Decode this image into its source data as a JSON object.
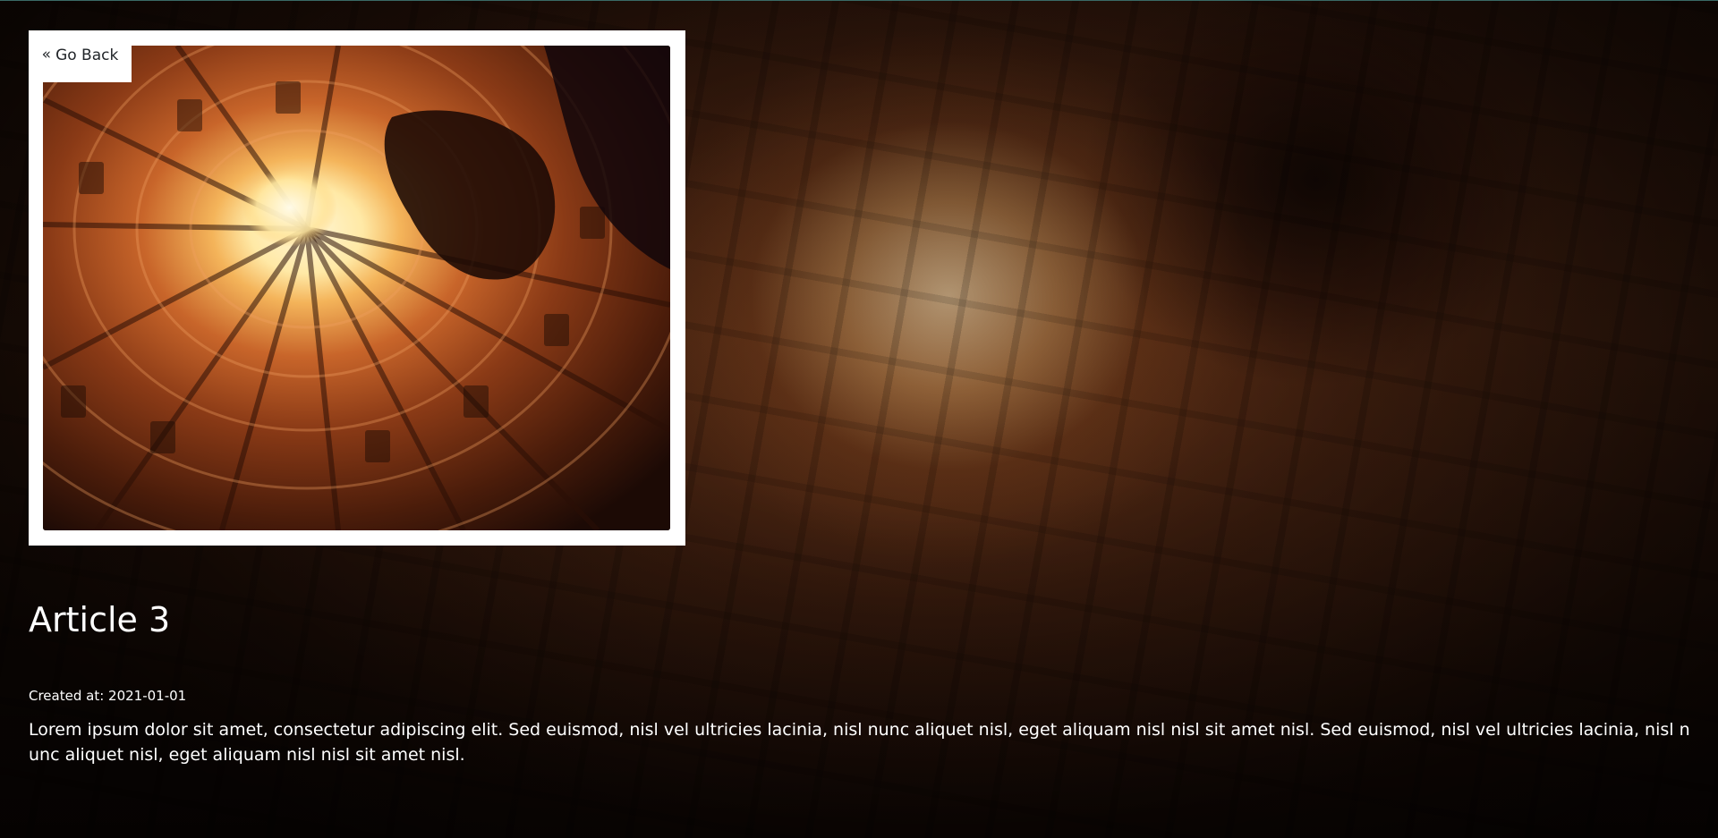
{
  "navigation": {
    "back_label": "Go Back",
    "back_icon": "double-chevron-left-icon"
  },
  "article": {
    "title": "Article 3",
    "created_at": "Created at: 2021-01-01",
    "body": "Lorem ipsum dolor sit amet, consectetur adipiscing elit. Sed euismod, nisl vel ultricies lacinia, nisl nunc aliquet nisl, eget aliquam nisl nisl sit amet nisl. Sed euismod, nisl vel ultricies lacinia, nisl nunc aliquet nisl, eget aliquam nisl nisl sit amet nisl."
  },
  "image": {
    "subject": "looking-up courtyard of building with bright sky opening"
  },
  "colors": {
    "text": "#ffffff",
    "card": "#ffffff",
    "button_text": "#212529",
    "warm_accent": "#c86a2c"
  }
}
